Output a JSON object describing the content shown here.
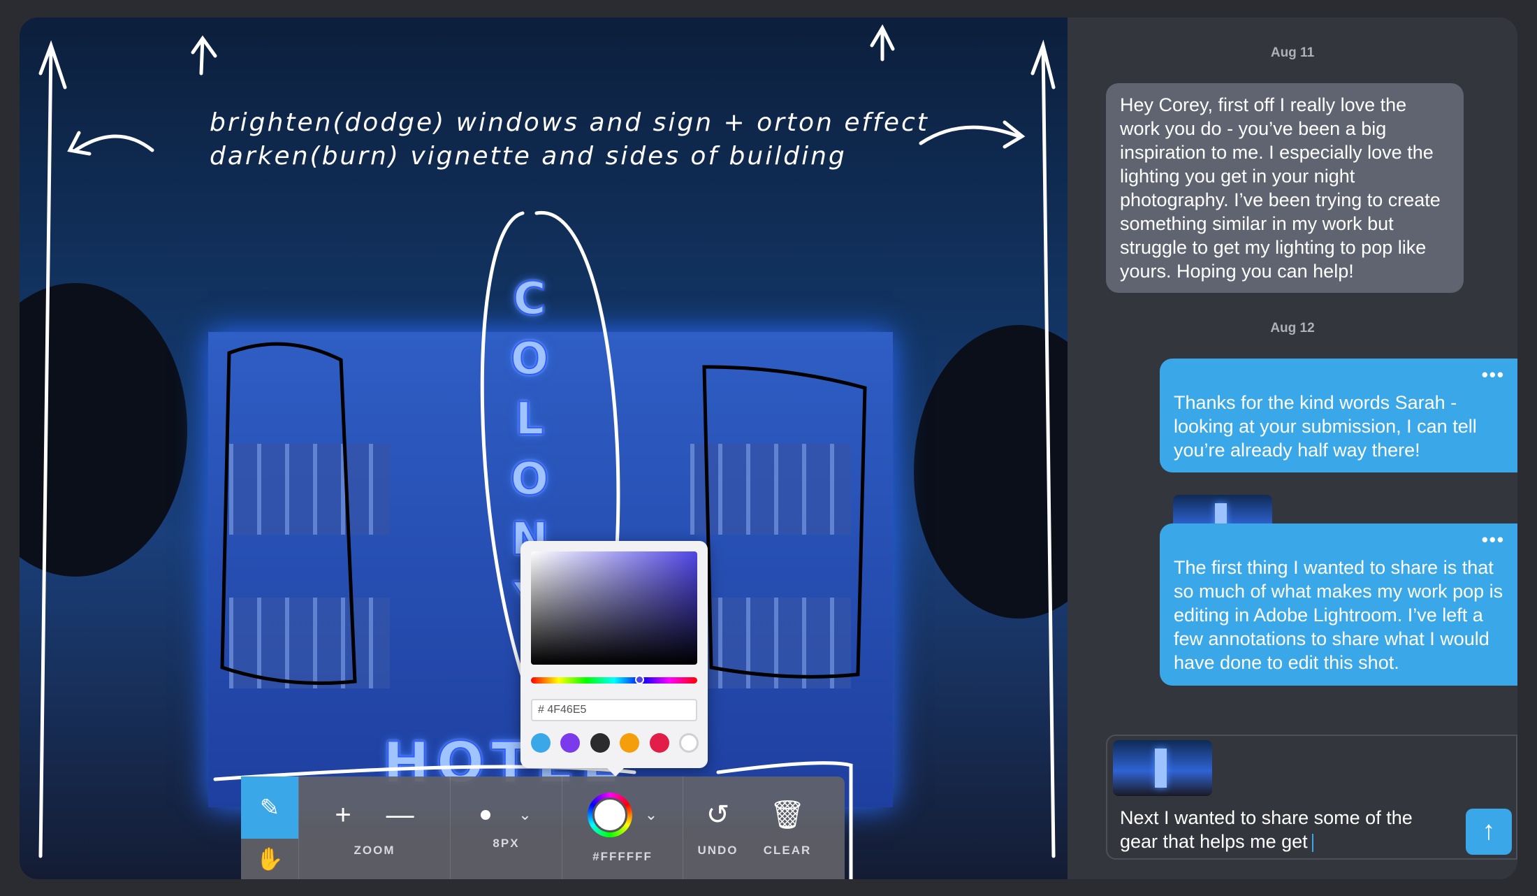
{
  "photo": {
    "annotation_line1": "brighten(dodge) windows and sign + orton effect",
    "annotation_line2": "darken(burn) vignette and sides of building",
    "sign_letters": "COLONY",
    "sign_hotel": "HOTEL"
  },
  "color_picker": {
    "hex_value": "# 4F46E5",
    "hue_position_percent": 65,
    "swatches": [
      "#3aa8e8",
      "#7c3aed",
      "#2b2b2e",
      "#f59e0b",
      "#e11d48",
      "#ffffff"
    ]
  },
  "toolbar": {
    "draw_tool": "pencil-icon",
    "pan_tool": "hand-icon",
    "zoom_label": "ZOOM",
    "zoom_in": "+",
    "zoom_out": "—",
    "brush_size_label": "8PX",
    "color_label": "#FFFFFF",
    "undo_label": "UNDO",
    "clear_label": "CLEAR",
    "accent": "#3aa8e8"
  },
  "chat": {
    "date1": "Aug 11",
    "message1": "Hey Corey, first off I really love the work you do - you’ve been a big inspiration to me. I especially love the lighting you get in your night photography. I’ve been trying to create something similar in my work but struggle to get my lighting to pop like yours. Hoping you can help!",
    "date2": "Aug 12",
    "message2": "Thanks for the kind words Sarah - looking at your submission, I can tell you’re already half way there!",
    "message3": "The first thing I wanted to share is that so much of what makes my work pop is editing in Adobe Lightroom. I’ve left a few annotations to share what I would have done to edit this shot.",
    "more": "•••",
    "composer_text": "Next I wanted to share some of the gear that helps me get",
    "send_icon": "arrow-up-icon"
  }
}
